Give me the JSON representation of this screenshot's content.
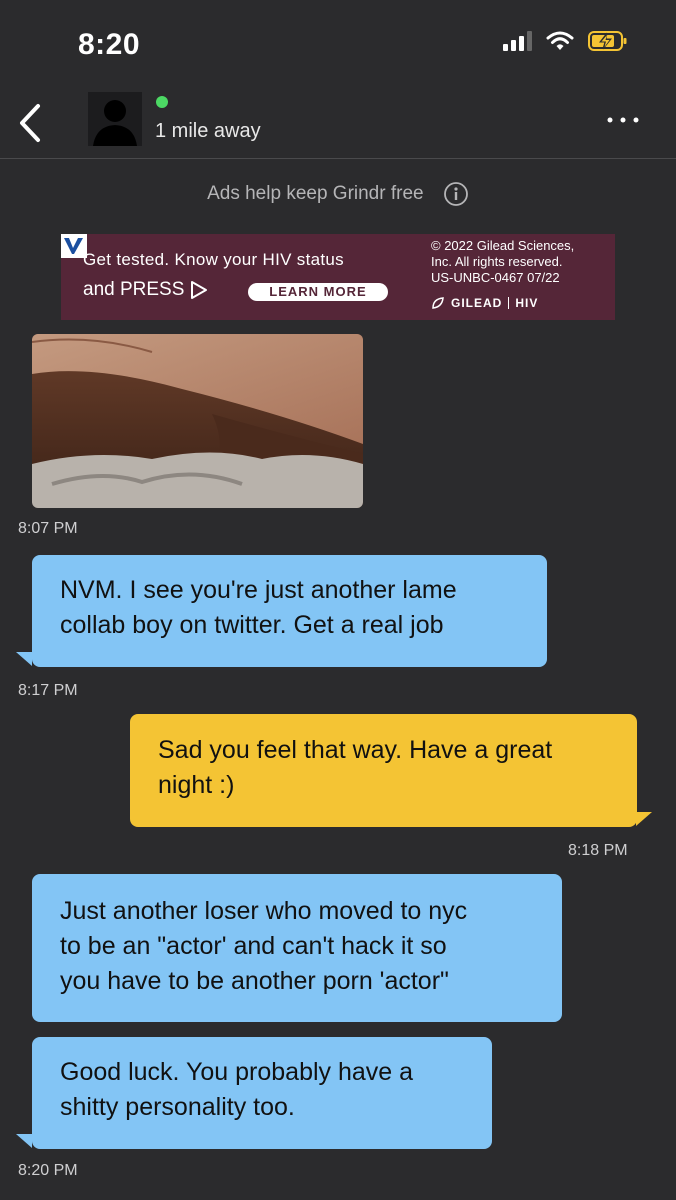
{
  "status_bar": {
    "time": "8:20"
  },
  "header": {
    "distance": "1 mile away"
  },
  "ads": {
    "notice": "Ads help keep Grindr free",
    "banner": {
      "line1": "Get tested. Know your HIV status",
      "press": "and PRESS",
      "cta": "LEARN MORE",
      "copyright": [
        "© 2022 Gilead Sciences,",
        "Inc. All rights reserved.",
        "US-UNBC-0467 07/22"
      ],
      "brand": "GILEAD",
      "brand_tag": "HIV"
    }
  },
  "messages": [
    {
      "type": "photo",
      "direction": "in",
      "time": "8:07 PM"
    },
    {
      "type": "text",
      "direction": "in",
      "lines": [
        "NVM. I see you're just another lame",
        "collab boy on twitter. Get a real job"
      ],
      "time": "8:17 PM"
    },
    {
      "type": "text",
      "direction": "out",
      "lines": [
        "Sad you feel that way. Have a great",
        "night :)"
      ],
      "time": "8:18 PM"
    },
    {
      "type": "text",
      "direction": "in",
      "lines": [
        "Just another loser who moved to nyc",
        "to be an \"actor'  and can't hack it so",
        "you have to be another porn 'actor\""
      ]
    },
    {
      "type": "text",
      "direction": "in",
      "lines": [
        "Good luck. You probably have a",
        "shitty personality too."
      ],
      "time": "8:20 PM"
    }
  ],
  "colors": {
    "background": "#2b2b2d",
    "incoming": "#83c5f5",
    "outgoing": "#f4c434",
    "ad": "#552638",
    "online": "#4cd964"
  }
}
